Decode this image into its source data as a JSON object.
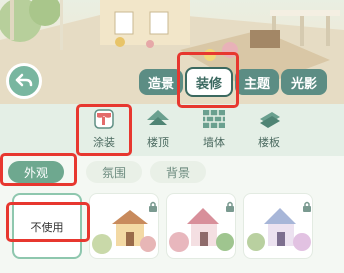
{
  "mode_tabs": [
    {
      "label": "造景"
    },
    {
      "label": "装修"
    },
    {
      "label": "主题"
    },
    {
      "label": "光影"
    }
  ],
  "categories": [
    {
      "label": "涂装",
      "icon": "paint-bucket-icon"
    },
    {
      "label": "楼顶",
      "icon": "roof-icon"
    },
    {
      "label": "墙体",
      "icon": "brick-wall-icon"
    },
    {
      "label": "楼板",
      "icon": "floor-board-icon"
    }
  ],
  "sub_tabs": [
    {
      "label": "外观"
    },
    {
      "label": "氛围"
    },
    {
      "label": "背景"
    }
  ],
  "items": [
    {
      "label": "不使用"
    },
    {
      "label": "",
      "icon": "house-preview-icon"
    },
    {
      "label": "",
      "icon": "house-preview-icon"
    },
    {
      "label": "",
      "icon": "house-preview-icon"
    }
  ],
  "colors": {
    "accent": "#5c8d84",
    "highlight": "#e7372f",
    "active_subtab": "#6ea88f"
  }
}
